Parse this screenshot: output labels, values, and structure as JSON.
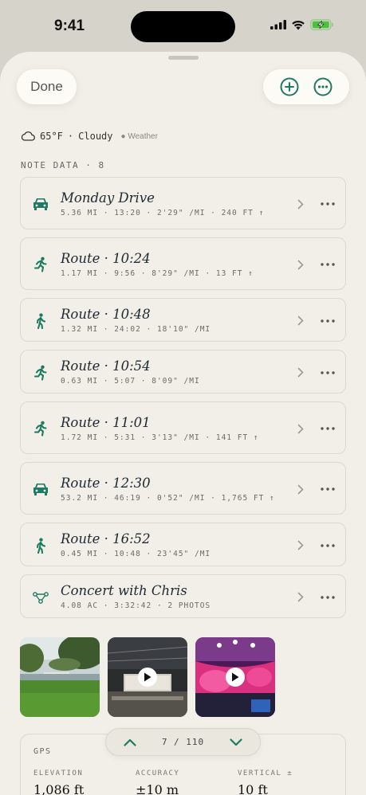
{
  "status": {
    "time": "9:41"
  },
  "toolbar": {
    "done_label": "Done"
  },
  "weather": {
    "temp": "65°F",
    "sep": "·",
    "condition": "Cloudy",
    "provider": "Weather"
  },
  "section": {
    "title": "NOTE DATA · 8"
  },
  "notes": [
    {
      "icon": "car-icon",
      "title": "Monday Drive",
      "meta": "5.36 MI · 13:20 · 2'29\" /MI · 240 FT ↑"
    },
    {
      "icon": "run-icon",
      "title": "Route · 10:24",
      "meta": "1.17 MI · 9:56 · 8'29\" /MI · 13 FT ↑"
    },
    {
      "icon": "walk-icon",
      "title": "Route · 10:48",
      "meta": "1.32 MI · 24:02 · 18'10\" /MI"
    },
    {
      "icon": "run-icon",
      "title": "Route · 10:54",
      "meta": "0.63 MI · 5:07 · 8'09\" /MI"
    },
    {
      "icon": "run-icon",
      "title": "Route · 11:01",
      "meta": "1.72 MI · 5:31 · 3'13\" /MI · 141 FT ↑"
    },
    {
      "icon": "car-icon",
      "title": "Route · 12:30",
      "meta": "53.2 MI · 46:19 · 0'52\" /MI · 1,765 FT ↑"
    },
    {
      "icon": "walk-icon",
      "title": "Route · 16:52",
      "meta": "0.45 MI · 10:48 · 23'45\" /MI"
    },
    {
      "icon": "polygon-icon",
      "title": "Concert with Chris",
      "meta": "4.08 AC · 3:32:42 · 2 PHOTOS"
    }
  ],
  "gps": {
    "title": "GPS",
    "elevation_label": "ELEVATION",
    "elevation_value": "1,086 ft",
    "accuracy_label": "ACCURACY",
    "accuracy_value": "±10 m",
    "vertical_label": "VERTICAL ±",
    "vertical_value": "10 ft"
  },
  "pager": {
    "count": "7 / 110"
  },
  "colors": {
    "accent": "#1f7a63",
    "background": "#f1efe7"
  }
}
